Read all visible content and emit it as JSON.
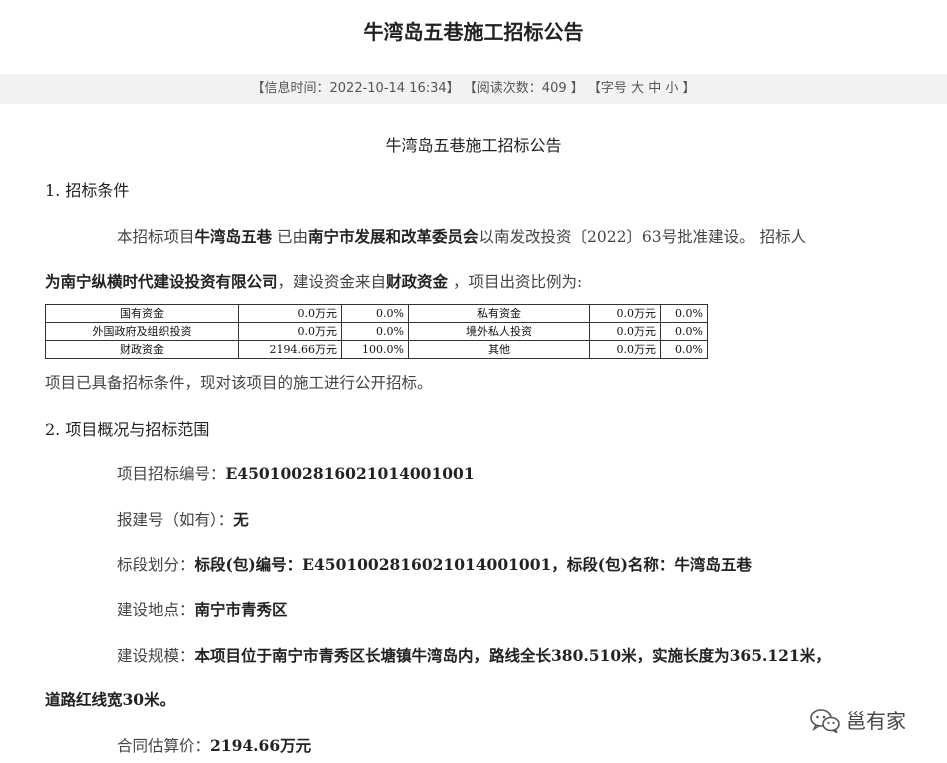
{
  "header": {
    "title": "牛湾岛五巷施工招标公告",
    "info_time": "【信息时间：2022-10-14 16:34】",
    "read_count": "【阅读次数：409 】",
    "font_size_prefix": "【字号 ",
    "font_large": "大",
    "font_medium": "中",
    "font_small": "小",
    "font_size_suffix": " 】"
  },
  "article": {
    "title": "牛湾岛五巷施工招标公告",
    "section1_heading": "1. 招标条件",
    "s1_p1_a": "本招标项目",
    "s1_p1_project": "牛湾岛五巷",
    "s1_p1_b": " 已由",
    "s1_p1_approver": "南宁市发展和改革委员会",
    "s1_p1_c": "以南发改投资〔2022〕63号批准建设。 招标人",
    "s1_p2_tenderer": "为南宁纵横时代建设投资有限公司",
    "s1_p2_a": "，建设资金来自",
    "s1_p2_funding": "财政资金",
    "s1_p2_b": " ，项目出资比例为:",
    "funding_table": [
      [
        "国有资金",
        "0.0万元",
        "0.0%",
        "私有资金",
        "0.0万元",
        "0.0%"
      ],
      [
        "外国政府及组织投资",
        "0.0万元",
        "0.0%",
        "境外私人投资",
        "0.0万元",
        "0.0%"
      ],
      [
        "财政资金",
        "2194.66万元",
        "100.0%",
        "其他",
        "0.0万元",
        "0.0%"
      ]
    ],
    "s1_p3": "项目已具备招标条件，现对该项目的施工进行公开招标。",
    "section2_heading": "2. 项目概况与招标范围",
    "tender_no_label": "项目招标编号：",
    "tender_no_value": "E4501002816021014001001",
    "report_no_label": "报建号（如有）：",
    "report_no_value": "无",
    "lot_label": "标段划分：",
    "lot_value": "标段(包)编号：E4501002816021014001001，标段(包)名称：牛湾岛五巷",
    "location_label": "建设地点：",
    "location_value": "南宁市青秀区",
    "scale_label": "建设规模：",
    "scale_value_line1": "本项目位于南宁市青秀区长塘镇牛湾岛内，路线全长380.510米，实施长度为365.121米，",
    "scale_value_line2": "道路红线宽30米。",
    "price_label": "合同估算价：",
    "price_value": "2194.66万元"
  },
  "watermark": {
    "text": "邕有家"
  }
}
